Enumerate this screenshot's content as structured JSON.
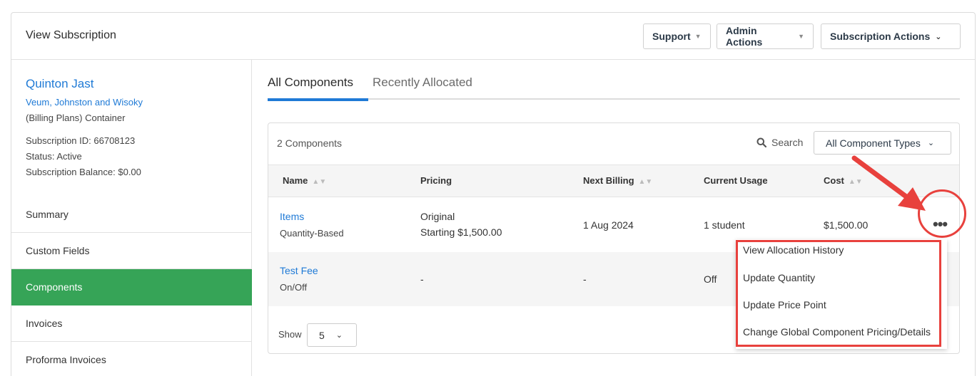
{
  "header": {
    "title": "View Subscription",
    "support_label": "Support",
    "admin_label": "Admin Actions",
    "subscription_actions_label": "Subscription Actions"
  },
  "customer": {
    "name": "Quinton Jast",
    "organization": "Veum, Johnston and Wisoky",
    "plan": "(Billing Plans) Container",
    "subscription_id": "Subscription ID: 66708123",
    "status": "Status: Active",
    "balance": "Subscription Balance: $0.00"
  },
  "sidebar": {
    "items": [
      {
        "label": "Summary"
      },
      {
        "label": "Custom Fields"
      },
      {
        "label": "Components",
        "active": true
      },
      {
        "label": "Invoices"
      },
      {
        "label": "Proforma Invoices"
      }
    ]
  },
  "tabs": [
    {
      "label": "All Components",
      "active": true
    },
    {
      "label": "Recently Allocated"
    }
  ],
  "panel": {
    "count": "2 Components",
    "search_label": "Search",
    "filter_label": "All Component Types",
    "columns": [
      "Name",
      "Pricing",
      "Next Billing",
      "Current Usage",
      "Cost"
    ],
    "rows": [
      {
        "name": "Items",
        "type": "Quantity-Based",
        "pricing_line1": "Original",
        "pricing_line2": "Starting $1,500.00",
        "next_billing": "1 Aug 2024",
        "usage": "1 student",
        "cost": "$1,500.00"
      },
      {
        "name": "Test Fee",
        "type": "On/Off",
        "pricing_line1": "-",
        "next_billing": "-",
        "usage": "Off"
      }
    ],
    "show_label": "Show",
    "show_value": "5"
  },
  "row_menu": {
    "items": [
      "View Allocation History",
      "Update Quantity",
      "Update Price Point",
      "Change Global Component Pricing/Details"
    ]
  },
  "colors": {
    "accent": "#1f7ad6",
    "active_nav": "#36a457",
    "highlight": "#e8413d"
  }
}
